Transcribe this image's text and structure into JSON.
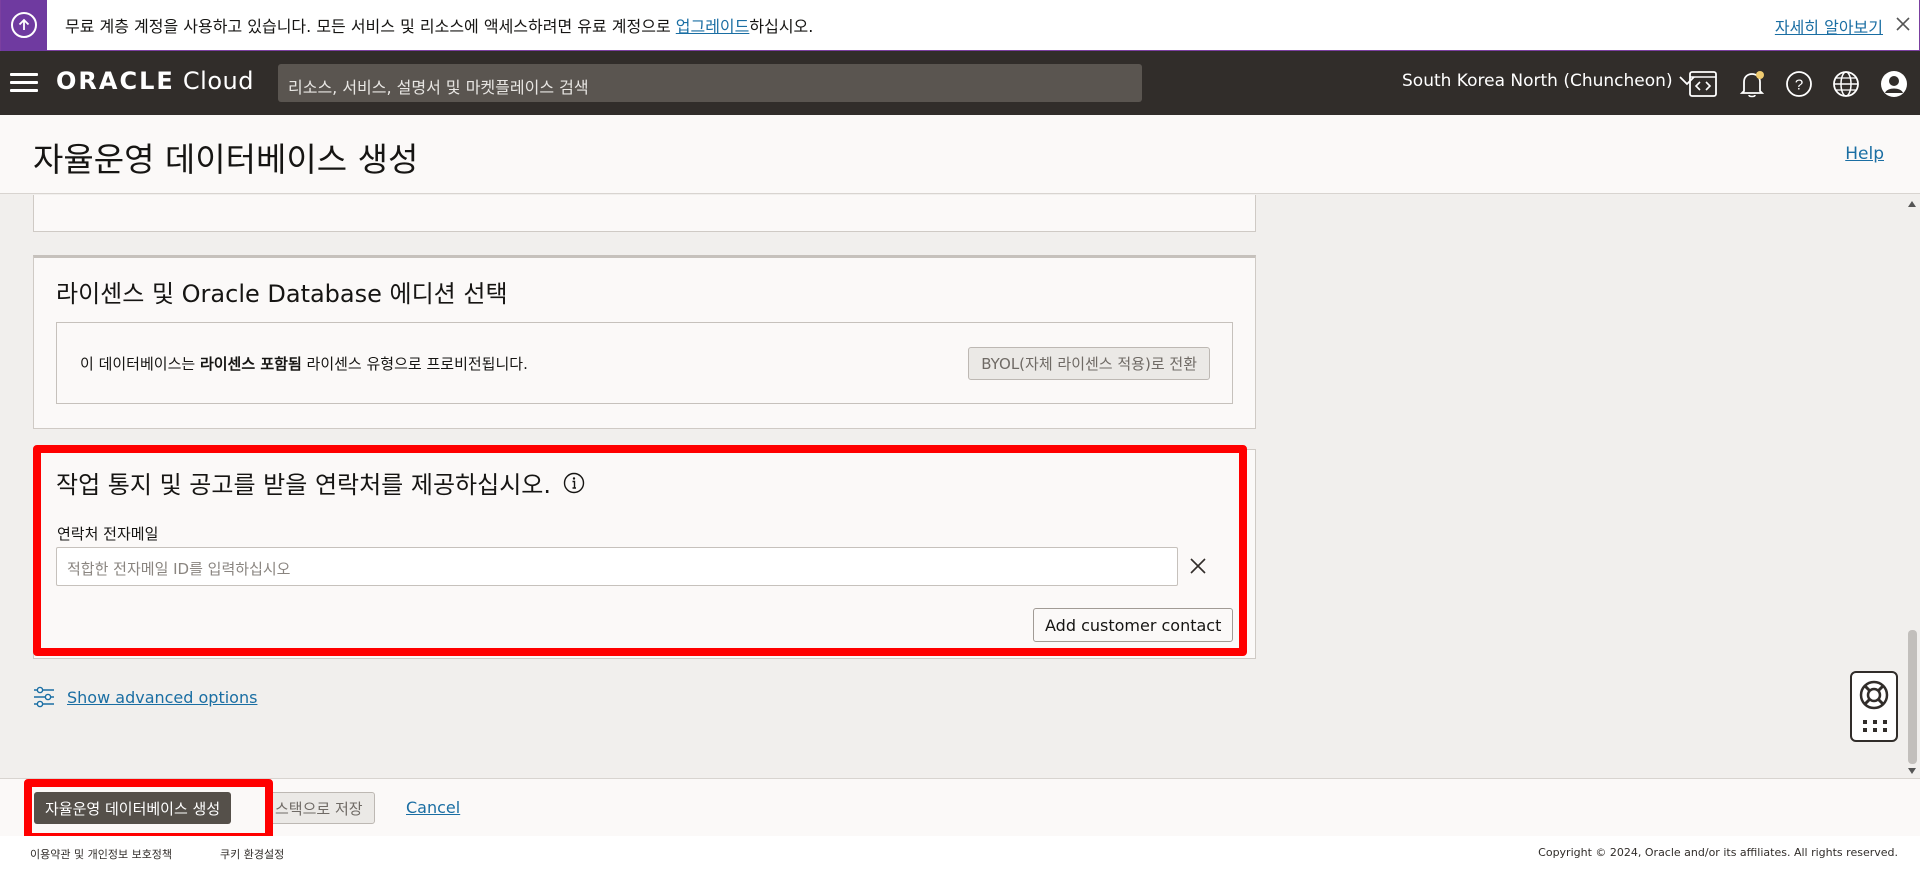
{
  "banner": {
    "text_before": "무료 계층 계정을 사용하고 있습니다. 모든 서비스 및 리소스에 액세스하려면 유료 계정으로 ",
    "upgrade_link": "업그레이드",
    "text_after": "하십시오.",
    "learn_more": "자세히 알아보기"
  },
  "nav": {
    "logo_oracle": "ORACLE",
    "logo_cloud": " Cloud",
    "search_placeholder": "리소스, 서비스, 설명서 및 마켓플레이스 검색",
    "region": "South Korea North (Chuncheon)"
  },
  "header": {
    "title": "자율운영 데이터베이스 생성",
    "help": "Help"
  },
  "license": {
    "title": "라이센스 및 Oracle Database 에디션 선택",
    "text_before": "이 데이터베이스는 ",
    "text_bold": "라이센스 포함됨",
    "text_after": " 라이센스 유형으로 프로비전됩니다.",
    "byol_button": "BYOL(자체 라이센스 적용)로 전환"
  },
  "contact": {
    "title": "작업 통지 및 공고를 받을 연락처를 제공하십시오.",
    "email_label": "연락처 전자메일",
    "email_placeholder": "적합한 전자메일 ID를 입력하십시오",
    "add_button": "Add customer contact"
  },
  "advanced": {
    "label": "Show advanced options"
  },
  "actions": {
    "create": "자율운영 데이터베이스 생성",
    "save_stack": "스택으로 저장",
    "cancel": "Cancel"
  },
  "footer": {
    "terms": "이용약관 및 개인정보 보호정책",
    "cookie": "쿠키 환경설정",
    "copyright": "Copyright © 2024, Oracle and/or its affiliates. All rights reserved."
  },
  "colors": {
    "accent_purple": "#6f3aa0",
    "nav_bg": "#312d2a",
    "link": "#1a6ea3",
    "highlight_red": "#ff0000"
  }
}
